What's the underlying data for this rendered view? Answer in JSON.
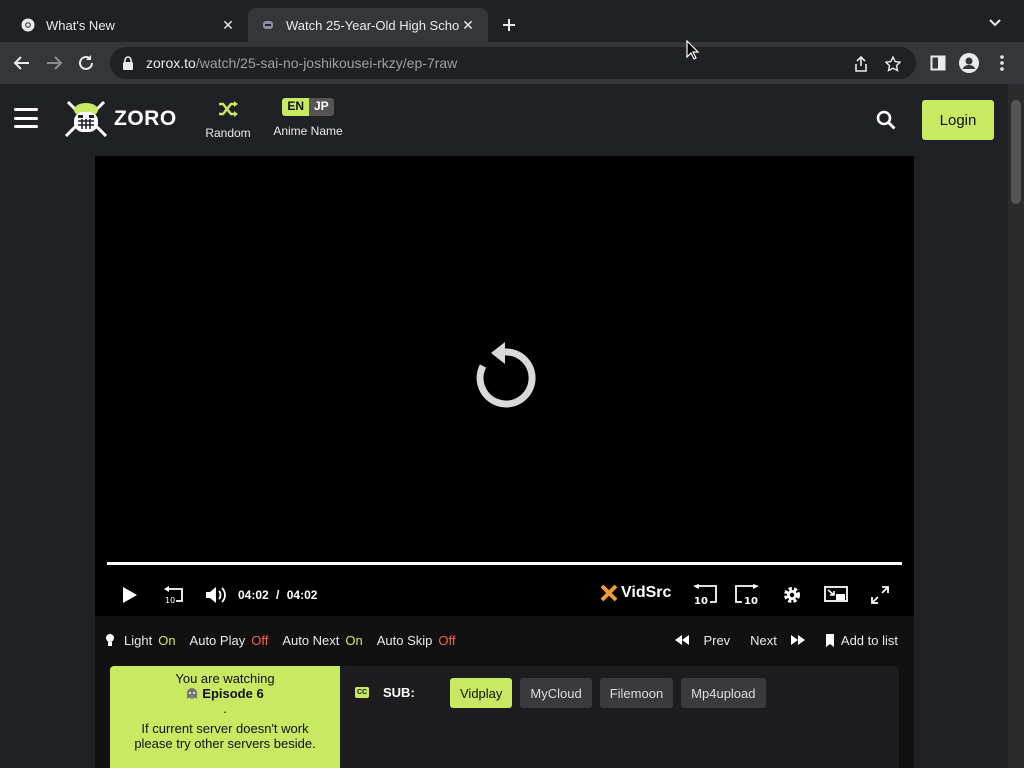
{
  "browser": {
    "tabs": [
      {
        "title": "What's New",
        "active": false
      },
      {
        "title": "Watch 25-Year-Old High Scho",
        "active": true
      }
    ],
    "url_host": "zorox.to",
    "url_path": "/watch/25-sai-no-joshikousei-rkzy/ep-7raw"
  },
  "header": {
    "brand": "ZORO",
    "random_label": "Random",
    "lang_en": "EN",
    "lang_jp": "JP",
    "anime_name_label": "Anime Name",
    "login_label": "Login"
  },
  "player": {
    "current_time": "04:02",
    "separator": "/",
    "duration": "04:02",
    "brand": "VidSrc",
    "progress_fraction": 1.0
  },
  "options": {
    "light_label": "Light",
    "light_value": "On",
    "autoplay_label": "Auto Play",
    "autoplay_value": "Off",
    "autonext_label": "Auto Next",
    "autonext_value": "On",
    "autoskip_label": "Auto Skip",
    "autoskip_value": "Off",
    "prev_label": "Prev",
    "next_label": "Next",
    "add_to_list_label": "Add to list"
  },
  "servers": {
    "watching_line1": "You are watching",
    "episode": "Episode 6",
    "dot": ".",
    "hint_line1": "If current server doesn't work",
    "hint_line2": "please try other servers beside.",
    "sub_label": "SUB:",
    "cc_text": "CC",
    "buttons": [
      "Vidplay",
      "MyCloud",
      "Filemoon",
      "Mp4upload"
    ],
    "active_button": "Vidplay"
  },
  "colors": {
    "accent": "#cae962",
    "off": "#ff5e5e",
    "page_bg": "#202125"
  }
}
